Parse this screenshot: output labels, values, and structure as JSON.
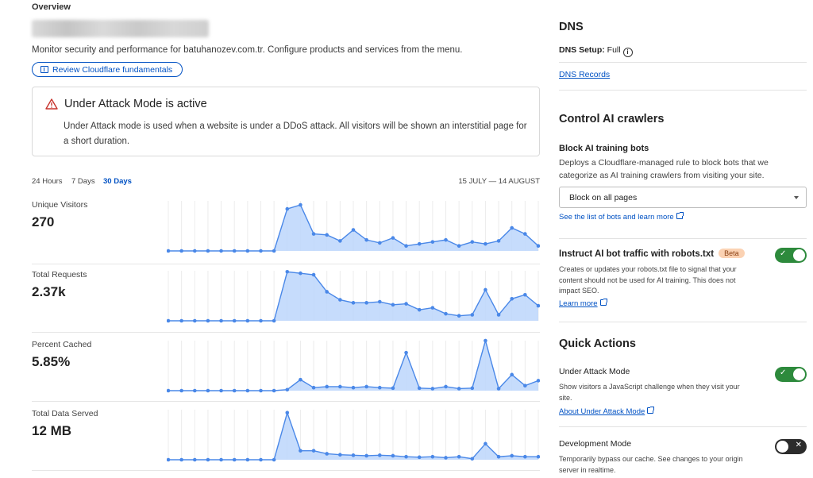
{
  "header": {
    "overview": "Overview",
    "monitor_text": "Monitor security and performance for batuhanozev.com.tr. Configure products and services from the menu.",
    "review_button": "Review Cloudflare fundamentals"
  },
  "alert": {
    "title": "Under Attack Mode is active",
    "body": "Under Attack mode is used when a website is under a DDoS attack. All visitors will be shown an interstitial page for a short duration."
  },
  "range": {
    "options": [
      "24 Hours",
      "7 Days",
      "30 Days"
    ],
    "active": "30 Days",
    "dates": "15 JULY — 14 AUGUST"
  },
  "metrics": [
    {
      "label": "Unique Visitors",
      "value": "270"
    },
    {
      "label": "Total Requests",
      "value": "2.37k"
    },
    {
      "label": "Percent Cached",
      "value": "5.85%"
    },
    {
      "label": "Total Data Served",
      "value": "12 MB"
    }
  ],
  "chart_data": [
    {
      "type": "area",
      "name": "Unique Visitors",
      "x_count": 29,
      "values": [
        0,
        0,
        0,
        0,
        0,
        0,
        0,
        0,
        0,
        84,
        92,
        34,
        32,
        20,
        42,
        22,
        16,
        26,
        10,
        14,
        18,
        22,
        10,
        18,
        14,
        20,
        46,
        34,
        10
      ]
    },
    {
      "type": "area",
      "name": "Total Requests",
      "x_count": 29,
      "values": [
        0,
        0,
        0,
        0,
        0,
        0,
        0,
        0,
        0,
        98,
        95,
        92,
        58,
        42,
        36,
        36,
        38,
        32,
        34,
        22,
        26,
        14,
        10,
        12,
        62,
        12,
        44,
        52,
        30
      ]
    },
    {
      "type": "area",
      "name": "Percent Cached",
      "x_count": 29,
      "values": [
        0,
        0,
        0,
        0,
        0,
        0,
        0,
        0,
        0,
        2,
        22,
        6,
        8,
        8,
        6,
        8,
        6,
        5,
        76,
        5,
        4,
        8,
        4,
        5,
        100,
        4,
        32,
        10,
        20
      ]
    },
    {
      "type": "area",
      "name": "Total Data Served",
      "x_count": 29,
      "values": [
        0,
        0,
        0,
        0,
        0,
        0,
        0,
        0,
        0,
        94,
        18,
        18,
        12,
        10,
        9,
        8,
        9,
        8,
        6,
        5,
        6,
        4,
        6,
        2,
        32,
        6,
        8,
        6,
        6
      ]
    }
  ],
  "dns": {
    "title": "DNS",
    "setup_label": "DNS Setup:",
    "setup_value": "Full",
    "records_link": "DNS Records"
  },
  "ai_crawlers": {
    "title": "Control AI crawlers",
    "block_title": "Block AI training bots",
    "block_desc": "Deploys a Cloudflare-managed rule to block bots that we categorize as AI training crawlers from visiting your site.",
    "select_value": "Block on all pages",
    "bots_link": "See the list of bots and learn more",
    "robots_title": "Instruct AI bot traffic with robots.txt",
    "robots_badge": "Beta",
    "robots_desc": "Creates or updates your robots.txt file to signal that your content should not be used for AI training. This does not impact SEO.",
    "robots_link": "Learn more",
    "robots_enabled": true
  },
  "quick_actions": {
    "title": "Quick Actions",
    "uam_title": "Under Attack Mode",
    "uam_desc": "Show visitors a JavaScript challenge when they visit your site.",
    "uam_link": "About Under Attack Mode",
    "uam_enabled": true,
    "dev_title": "Development Mode",
    "dev_desc": "Temporarily bypass our cache. See changes to your origin server in realtime.",
    "dev_enabled": false
  },
  "colors": {
    "accent": "#0051c3",
    "chart_fill": "#bcd6fb",
    "chart_line": "#4a88e8",
    "toggle_on": "#2d8a3c"
  }
}
